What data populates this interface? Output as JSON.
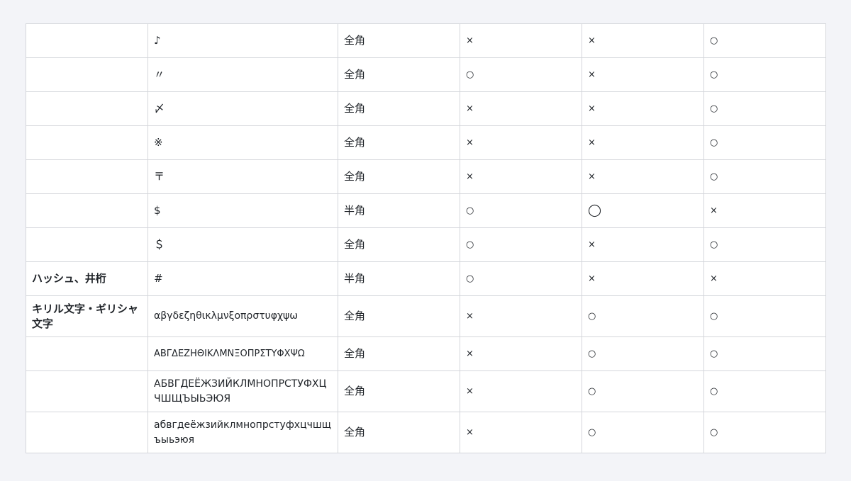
{
  "rows": [
    {
      "category": "",
      "char": "♪",
      "width": "全角",
      "a": "×",
      "b": "×",
      "c": "○"
    },
    {
      "category": "",
      "char": "〃",
      "width": "全角",
      "a": "○",
      "b": "×",
      "c": "○"
    },
    {
      "category": "",
      "char": "〆",
      "width": "全角",
      "a": "×",
      "b": "×",
      "c": "○"
    },
    {
      "category": "",
      "char": "※",
      "width": "全角",
      "a": "×",
      "b": "×",
      "c": "○"
    },
    {
      "category": "",
      "char": "〒",
      "width": "全角",
      "a": "×",
      "b": "×",
      "c": "○"
    },
    {
      "category": "",
      "char": "$",
      "width": "半角",
      "a": "○",
      "b": "◯",
      "c": "×"
    },
    {
      "category": "",
      "char": "＄",
      "width": "全角",
      "a": "○",
      "b": "×",
      "c": "○"
    },
    {
      "category": "ハッシュ、井桁",
      "char": "#",
      "width": "半角",
      "a": "○",
      "b": "×",
      "c": "×"
    },
    {
      "category": "キリル文字・ギリシャ文字",
      "char": "αβγδεζηθικλμνξοπρστυφχψω",
      "width": "全角",
      "a": "×",
      "b": "○",
      "c": "○"
    },
    {
      "category": "",
      "char": "ΑΒΓΔΕΖΗΘΙΚΛΜΝΞΟΠΡΣΤΥΦΧΨΩ",
      "width": "全角",
      "a": "×",
      "b": "○",
      "c": "○"
    },
    {
      "category": "",
      "char": "АБВГДЕЁЖЗИЙКЛМНОПРСТУФХЦЧШЩЪЫЬЭЮЯ",
      "width": "全角",
      "a": "×",
      "b": "○",
      "c": "○"
    },
    {
      "category": "",
      "char": "абвгдеёжзийклмнопрстуфхцчшщъыьэюя",
      "width": "全角",
      "a": "×",
      "b": "○",
      "c": "○"
    }
  ]
}
